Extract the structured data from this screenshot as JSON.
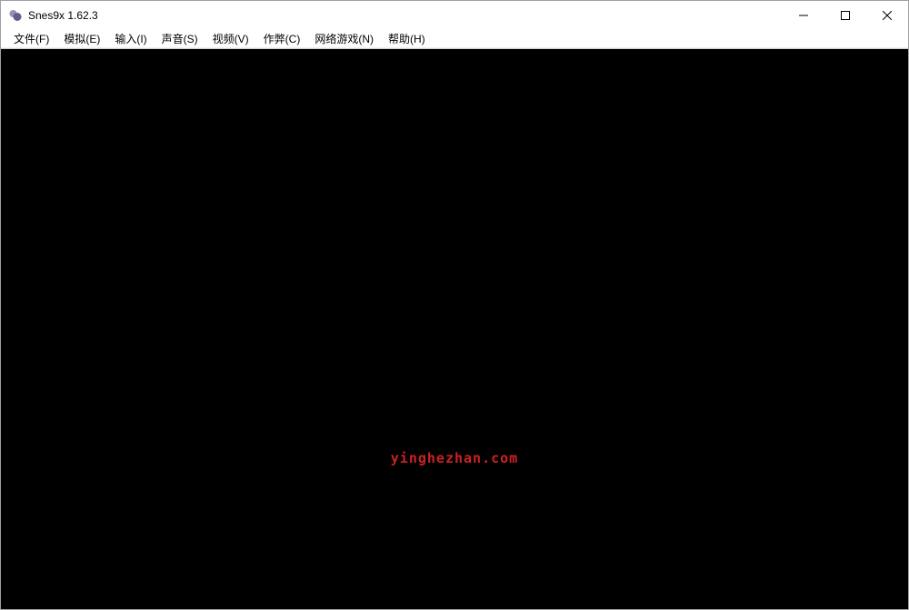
{
  "window": {
    "title": "Snes9x 1.62.3"
  },
  "menu": {
    "file": "文件(F)",
    "emulation": "模拟(E)",
    "input": "输入(I)",
    "sound": "声音(S)",
    "video": "视频(V)",
    "cheat": "作弊(C)",
    "netplay": "网络游戏(N)",
    "help": "帮助(H)"
  },
  "watermark": {
    "text": "yinghezhan.com"
  }
}
